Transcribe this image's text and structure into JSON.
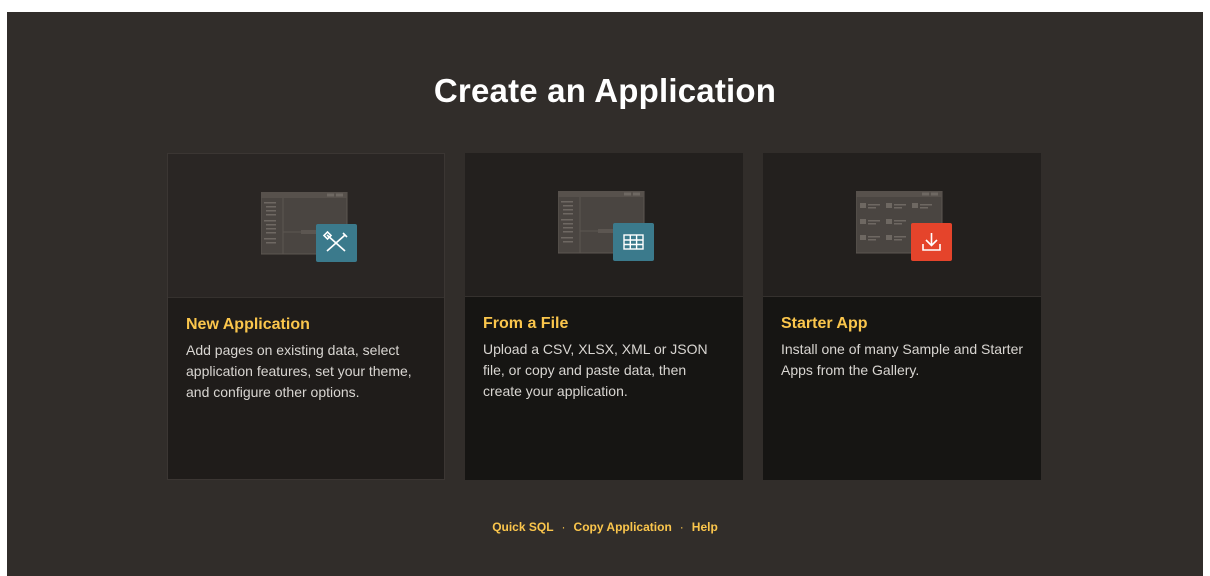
{
  "page": {
    "title": "Create an Application"
  },
  "cards": [
    {
      "title": "New Application",
      "description": "Add pages on existing data, select application features, set your theme, and configure other options.",
      "icon": "edit-tools-icon",
      "badge_color": "#3b7a8c"
    },
    {
      "title": "From a File",
      "description": "Upload a CSV, XLSX, XML or JSON file, or copy and paste data, then create your application.",
      "icon": "table-icon",
      "badge_color": "#3b7a8c"
    },
    {
      "title": "Starter App",
      "description": "Install one of many Sample and Starter Apps from the Gallery.",
      "icon": "download-icon",
      "badge_color": "#e5442b"
    }
  ],
  "footer": {
    "links": [
      "Quick SQL",
      "Copy Application",
      "Help"
    ],
    "separator": "·"
  },
  "colors": {
    "background": "#312d2a",
    "accent": "#fbc64c",
    "card": "#161513"
  }
}
